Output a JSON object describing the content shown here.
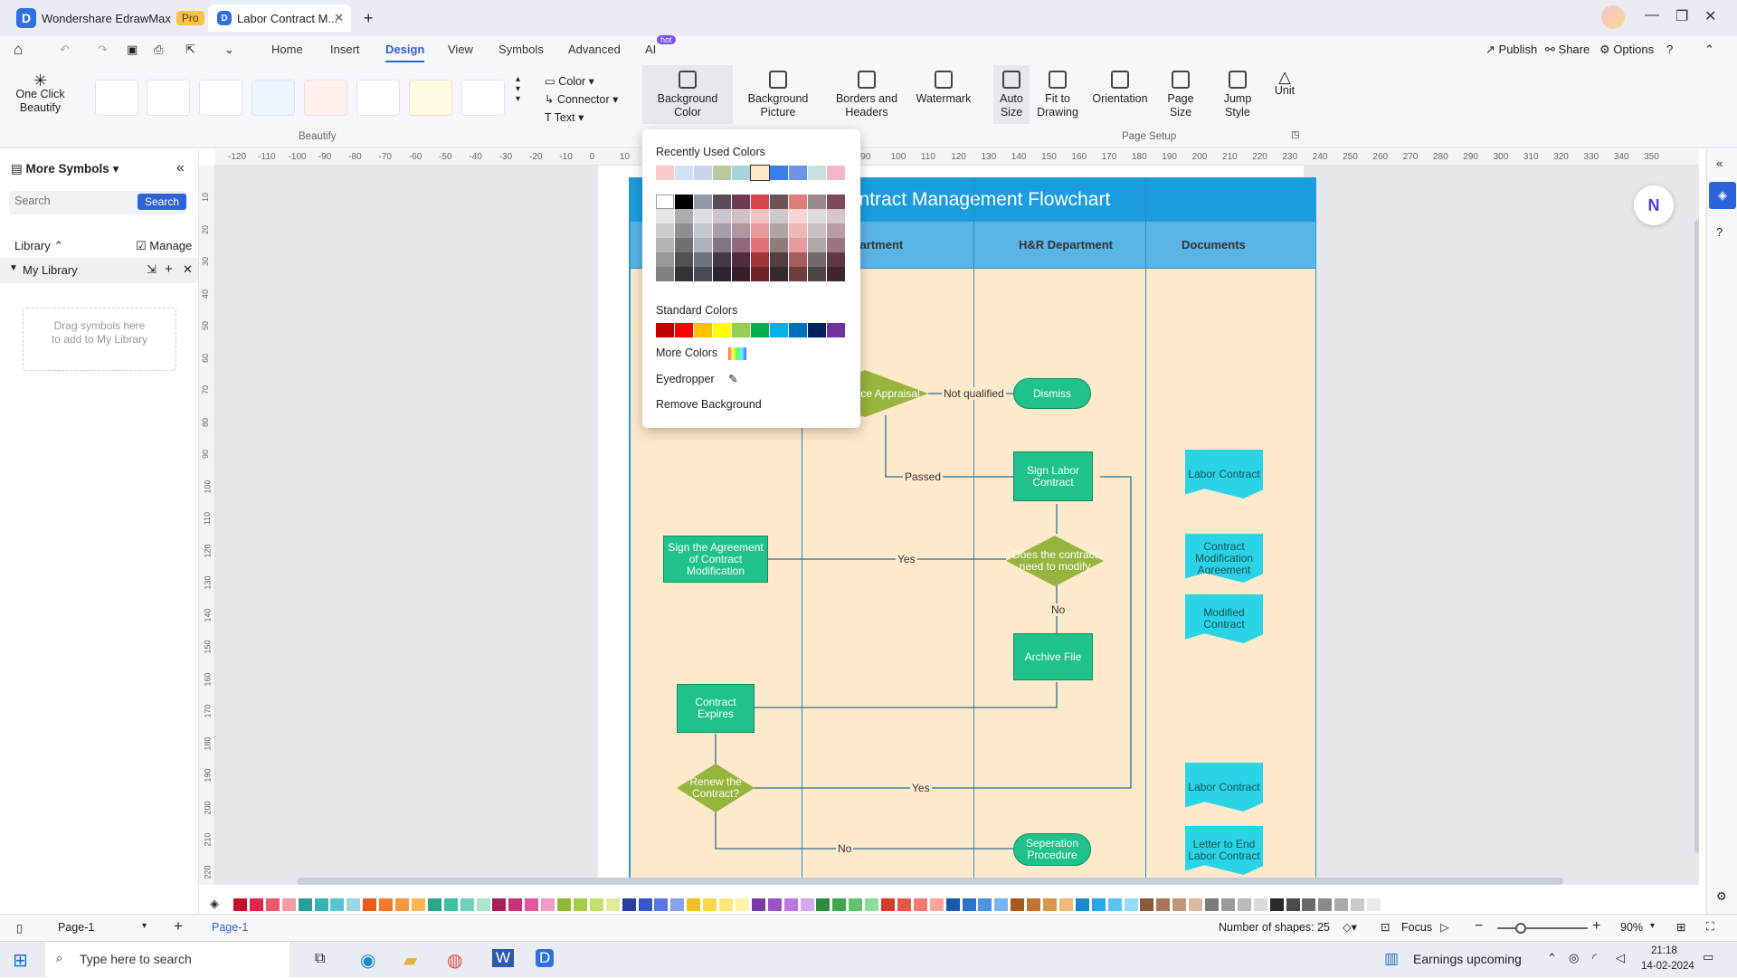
{
  "window": {
    "app_tab": "Wondershare EdrawMax",
    "pro_badge": "Pro",
    "doc_tab": "Labor Contract M...",
    "new_tab": "+"
  },
  "menu": {
    "items": [
      "Home",
      "Insert",
      "Design",
      "View",
      "Symbols",
      "Advanced",
      "AI"
    ],
    "ai_badge": "hot",
    "active": "Design",
    "publish": "Publish",
    "share": "Share",
    "options": "Options"
  },
  "ribbon": {
    "one_click": "One Click Beautify",
    "beautify_group": "Beautify",
    "color": "Color",
    "connector": "Connector",
    "text": "Text",
    "bg_color": "Background Color",
    "bg_picture": "Background Picture",
    "borders": "Borders and Headers",
    "watermark": "Watermark",
    "auto_size": "Auto Size",
    "fit": "Fit to Drawing",
    "orientation": "Orientation",
    "page_size": "Page Size",
    "jump": "Jump Style",
    "unit": "Unit",
    "page_setup_group": "Page Setup"
  },
  "sidebar": {
    "title": "More Symbols",
    "search_placeholder": "Search",
    "search_btn": "Search",
    "library": "Library",
    "manage": "Manage",
    "my_library": "My Library",
    "drop_hint": "Drag symbols here to add to My Library"
  },
  "ruler": {
    "top": [
      "-120",
      "-110",
      "-100",
      "-90",
      "-80",
      "-70",
      "-60",
      "-50",
      "-40",
      "-30",
      "-20",
      "-10",
      "0",
      "10",
      "20",
      "30",
      "40",
      "50",
      "60",
      "70",
      "80",
      "90",
      "100",
      "110",
      "120",
      "130",
      "140",
      "150",
      "160",
      "170",
      "180",
      "190",
      "200",
      "210",
      "220",
      "230",
      "240",
      "250",
      "260",
      "270",
      "280",
      "290",
      "300",
      "310",
      "320",
      "330",
      "340",
      "350"
    ],
    "left": [
      "10",
      "20",
      "30",
      "40",
      "50",
      "60",
      "70",
      "80",
      "90",
      "100",
      "110",
      "120",
      "130",
      "140",
      "150",
      "160",
      "170",
      "180",
      "190",
      "200",
      "210",
      "220"
    ]
  },
  "diagram": {
    "title": "Contract Management Flowchart",
    "lanes": [
      "Department",
      "H&R Department",
      "Documents"
    ],
    "nodes": {
      "appraisal": "Performance Appraisal",
      "dismiss": "Dismiss",
      "sign": "Sign Labor Contract",
      "modify_q": "Does the contract need to modify",
      "sign_mod": "Sign the Agreement of Contract Modification",
      "archive": "Archive File",
      "expires": "Contract Expires",
      "renew": "Renew the Contract?",
      "separation": "Seperation Procedure"
    },
    "docs": [
      "Labor Contract",
      "Contract Modification Agreement",
      "Modified Contract",
      "Labor Contract",
      "Letter to End Labor Contract"
    ],
    "labels": {
      "not_qualified": "Not qualified",
      "passed": "Passed",
      "yes1": "Yes",
      "no1": "No",
      "yes2": "Yes",
      "no2": "No"
    }
  },
  "popup": {
    "recent": "Recently Used Colors",
    "standard": "Standard Colors",
    "more": "More Colors",
    "eyedropper": "Eyedropper",
    "remove": "Remove Background",
    "recent_colors": [
      "#f9c9c9",
      "#cfe0f7",
      "#c9d3f0",
      "#b9c99a",
      "#a9d3dc",
      "#fde9cc",
      "#3a7ee8",
      "#6b93e6",
      "#c7e0e0",
      "#f3b8c8"
    ],
    "base_colors": [
      "#ffffff",
      "#000000",
      "#9497a6",
      "#5a4a5a",
      "#6e3a4e",
      "#d7444e",
      "#6a5456",
      "#e07c7c",
      "#9a8a8e",
      "#7e4a5a"
    ],
    "standard_colors": [
      "#c00000",
      "#ff0000",
      "#ffc000",
      "#ffff00",
      "#92d050",
      "#00b050",
      "#00b0f0",
      "#0070c0",
      "#002060",
      "#7030a0"
    ]
  },
  "palette": [
    "#c8102e",
    "#e0284a",
    "#f0566e",
    "#f799a8",
    "#2a9c9c",
    "#36b3b3",
    "#54c8d0",
    "#9ad7df",
    "#e85c1a",
    "#f27a2e",
    "#f7983e",
    "#fbb555",
    "#2aa58a",
    "#3cbf9e",
    "#6fd4b7",
    "#a8e6cf",
    "#a81e5a",
    "#c93478",
    "#e357a0",
    "#f29ac6",
    "#8fb83a",
    "#a8cc4a",
    "#c2df70",
    "#dcee9e",
    "#2a3ea0",
    "#3a56c8",
    "#5a76e0",
    "#8aa0f0",
    "#f0c020",
    "#f7d848",
    "#fbe678",
    "#fdf2a8",
    "#7a3aa8",
    "#9a52c8",
    "#b878e0",
    "#d4a8f0",
    "#2e8a3e",
    "#3ea64e",
    "#5ec26e",
    "#8edc9a",
    "#d83a2a",
    "#e8564a",
    "#f27a6e",
    "#f8a49c",
    "#1a5aa8",
    "#2a74c8",
    "#4a94e0",
    "#7ab4f0",
    "#a85a1a",
    "#c4742a",
    "#dc9448",
    "#eeb878",
    "#1a8ad0",
    "#2aa6e8",
    "#5ac2f4",
    "#94dcfa",
    "#8a5a3a",
    "#a8745a",
    "#c4947a",
    "#dcb8a4",
    "#7a7a7a",
    "#9a9a9a",
    "#bababa",
    "#dadada",
    "#2a2a2a",
    "#4a4a4a",
    "#6a6a6a",
    "#8a8a8a",
    "#aaaaaa",
    "#cacaca",
    "#eaeaea"
  ],
  "status": {
    "page_sel": "Page-1",
    "page_tab": "Page-1",
    "shapes": "Number of shapes: 25",
    "focus": "Focus",
    "zoom": "90%"
  },
  "taskbar": {
    "search": "Type here to search",
    "earnings": "Earnings upcoming",
    "time": "21:18",
    "date": "14-02-2024"
  }
}
